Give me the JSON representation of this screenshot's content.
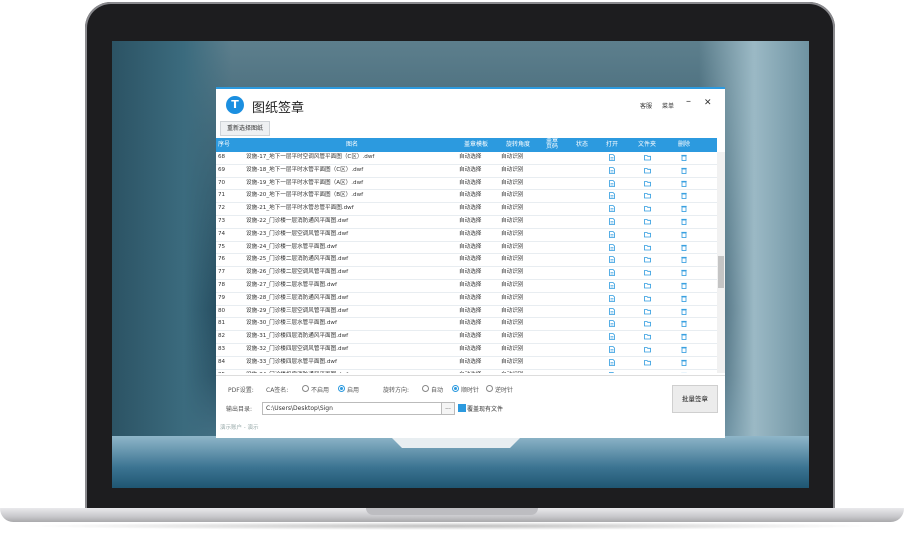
{
  "app": {
    "title": "图纸签章",
    "logo_letter": "T"
  },
  "titlebar": {
    "service": "客服",
    "menu": "菜单",
    "minimize": "–",
    "close": "✕"
  },
  "toolbar": {
    "reselect_label": "重新选择图纸"
  },
  "table": {
    "headers": [
      "序号",
      "图名",
      "盖章模板",
      "旋转角度",
      "盖章\n页码",
      "状态",
      "打开",
      "文件夹",
      "删除"
    ],
    "rows": [
      {
        "no": "68",
        "name": "设施-17_地下一层平时空调风管平面图（C区）.dwf",
        "template": "自动选择",
        "rotation": "自动识别"
      },
      {
        "no": "69",
        "name": "设施-18_地下一层平时水管平面图（C区）.dwf",
        "template": "自动选择",
        "rotation": "自动识别"
      },
      {
        "no": "70",
        "name": "设施-19_地下一层平时水管平面图（A区）.dwf",
        "template": "自动选择",
        "rotation": "自动识别"
      },
      {
        "no": "71",
        "name": "设施-20_地下一层平时水管平面图（B区）.dwf",
        "template": "自动选择",
        "rotation": "自动识别"
      },
      {
        "no": "72",
        "name": "设施-21_地下一层平时水管总管平面图.dwf",
        "template": "自动选择",
        "rotation": "自动识别"
      },
      {
        "no": "73",
        "name": "设施-22_门诊楼一层消防通风平面图.dwf",
        "template": "自动选择",
        "rotation": "自动识别"
      },
      {
        "no": "74",
        "name": "设施-23_门诊楼一层空调风管平面图.dwf",
        "template": "自动选择",
        "rotation": "自动识别"
      },
      {
        "no": "75",
        "name": "设施-24_门诊楼一层水管平面图.dwf",
        "template": "自动选择",
        "rotation": "自动识别"
      },
      {
        "no": "76",
        "name": "设施-25_门诊楼二层消防通风平面图.dwf",
        "template": "自动选择",
        "rotation": "自动识别"
      },
      {
        "no": "77",
        "name": "设施-26_门诊楼二层空调风管平面图.dwf",
        "template": "自动选择",
        "rotation": "自动识别"
      },
      {
        "no": "78",
        "name": "设施-27_门诊楼二层水管平面图.dwf",
        "template": "自动选择",
        "rotation": "自动识别"
      },
      {
        "no": "79",
        "name": "设施-28_门诊楼三层消防通风平面图.dwf",
        "template": "自动选择",
        "rotation": "自动识别"
      },
      {
        "no": "80",
        "name": "设施-29_门诊楼三层空调风管平面图.dwf",
        "template": "自动选择",
        "rotation": "自动识别"
      },
      {
        "no": "81",
        "name": "设施-30_门诊楼三层水管平面图.dwf",
        "template": "自动选择",
        "rotation": "自动识别"
      },
      {
        "no": "82",
        "name": "设施-31_门诊楼四层消防通风平面图.dwf",
        "template": "自动选择",
        "rotation": "自动识别"
      },
      {
        "no": "83",
        "name": "设施-32_门诊楼四层空调风管平面图.dwf",
        "template": "自动选择",
        "rotation": "自动识别"
      },
      {
        "no": "84",
        "name": "设施-33_门诊楼四层水管平面图.dwf",
        "template": "自动选择",
        "rotation": "自动识别"
      },
      {
        "no": "85",
        "name": "设施-34_门诊楼机房消防通风平面图.dwf",
        "template": "自动选择",
        "rotation": "自动识别"
      }
    ]
  },
  "settings": {
    "pdf_label": "PDF设置:",
    "ca_label": "CA签名:",
    "ca_options": [
      "不启用",
      "启用"
    ],
    "ca_selected": "启用",
    "rotate_label": "旋转方向:",
    "rotate_options": [
      "自动",
      "顺时针",
      "逆时针"
    ],
    "rotate_selected": "顺时针",
    "output_label": "输出目录:",
    "output_path": "C:\\Users\\Desktop\\Sign",
    "browse_label": "...",
    "overwrite_label": "覆盖现有文件",
    "overwrite_checked": true,
    "batch_button": "批量签章",
    "status_text": "演示账户 - 演示"
  },
  "colors": {
    "accent": "#2c9adf",
    "header_text": "#ffffff",
    "file_icon": "#2c9adf"
  }
}
